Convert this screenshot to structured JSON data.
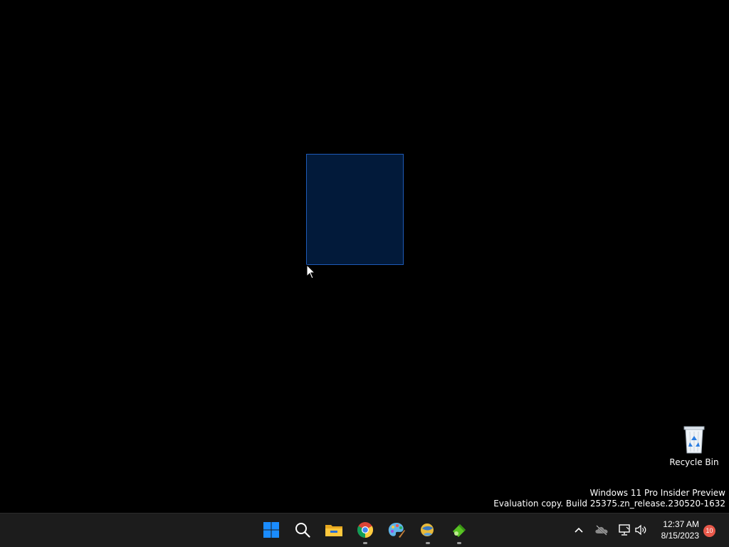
{
  "desktop": {
    "recycle_bin": {
      "label": "Recycle Bin",
      "icon": "recycle-bin-icon"
    },
    "watermark": {
      "line1": "Windows 11 Pro Insider Preview",
      "line2": "Evaluation copy. Build 25375.zn_release.230520-1632"
    }
  },
  "taskbar": {
    "apps": [
      {
        "name": "start",
        "icon": "windows-start-icon",
        "running": false
      },
      {
        "name": "search",
        "icon": "search-icon",
        "running": false
      },
      {
        "name": "file-explorer",
        "icon": "folder-icon",
        "running": false
      },
      {
        "name": "chrome",
        "icon": "chrome-icon",
        "running": true
      },
      {
        "name": "paint",
        "icon": "paint-palette-icon",
        "running": false
      },
      {
        "name": "app-6",
        "icon": "app-globe-icon",
        "running": true
      },
      {
        "name": "app-7",
        "icon": "app-green-icon",
        "running": true
      }
    ],
    "tray": {
      "icons": [
        "chevron-up-icon",
        "cloud-offline-icon",
        "network-icon",
        "volume-icon"
      ],
      "time": "12:37 AM",
      "date": "8/15/2023",
      "notification_count": "10"
    }
  },
  "colors": {
    "desktop_bg": "#000000",
    "taskbar_bg": "#1c1c1c",
    "selection_fill": "#021a3a",
    "selection_border": "#1e5bb8",
    "start_blue": "#1a8cff",
    "badge_red": "#e8584a"
  }
}
